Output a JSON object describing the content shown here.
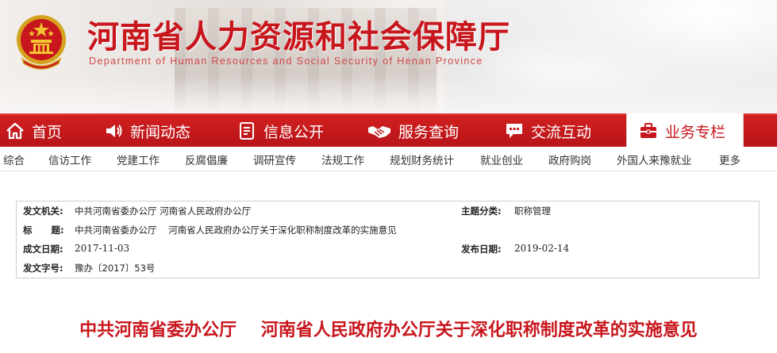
{
  "header": {
    "title": "河南省人力资源和社会保障厅",
    "subtitle": "Department of Human Resources and Social Security of Henan Province"
  },
  "nav": {
    "items": [
      {
        "label": "首页",
        "icon": "home-icon"
      },
      {
        "label": "新闻动态",
        "icon": "speaker-icon"
      },
      {
        "label": "信息公开",
        "icon": "document-icon"
      },
      {
        "label": "服务查询",
        "icon": "handshake-icon"
      },
      {
        "label": "交流互动",
        "icon": "chat-icon"
      },
      {
        "label": "业务专栏",
        "icon": "briefcase-icon",
        "active": true
      }
    ]
  },
  "subnav": {
    "items": [
      "综合",
      "信访工作",
      "党建工作",
      "反腐倡廉",
      "调研宣传",
      "法规工作",
      "规划财务统计",
      "就业创业",
      "政府购岗",
      "外国人来豫就业",
      "更多"
    ]
  },
  "meta": {
    "issuer_label": "发文机关:",
    "issuer_value": "中共河南省委办公厅    河南省人民政府办公厅",
    "category_label": "主题分类:",
    "category_value": "职称管理",
    "title_label": "标      题:",
    "title_value": "中共河南省委办公厅    河南省人民政府办公厅关于深化职称制度改革的实施意见",
    "created_label": "成文日期:",
    "created_value": "2017-11-03",
    "published_label": "发布日期:",
    "published_value": "2019-02-14",
    "docno_label": "发文字号:",
    "docno_value": "豫办〔2017〕53号"
  },
  "article": {
    "headline": "中共河南省委办公厅    河南省人民政府办公厅关于深化职称制度改革的实施意见"
  },
  "colors": {
    "brand_red": "#c8161d",
    "nav_red": "#c0171b"
  }
}
